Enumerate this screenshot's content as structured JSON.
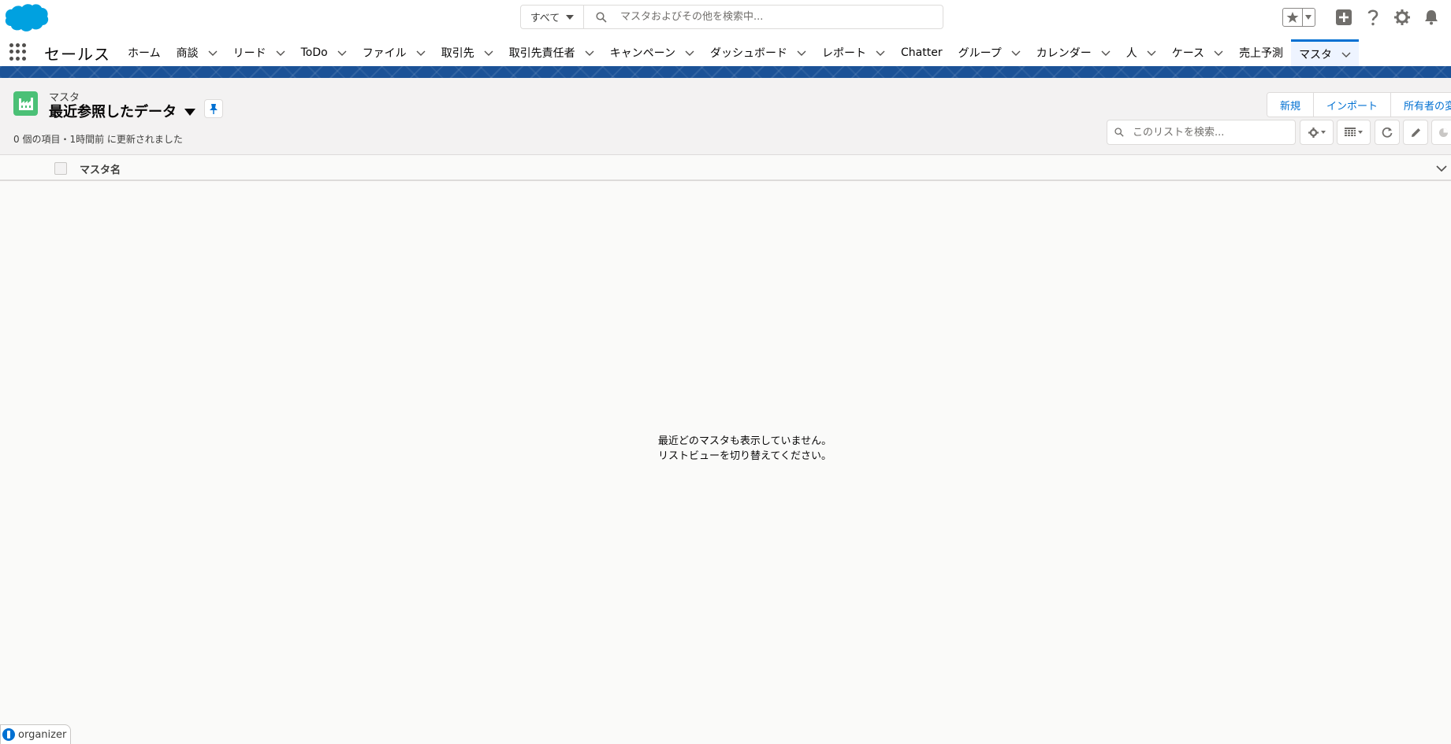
{
  "header": {
    "logo": "salesforce-cloud-logo",
    "search": {
      "scope_label": "すべて",
      "placeholder": "マスタおよびその他を検索中..."
    },
    "icons": [
      "star-icon",
      "chevron-down-icon",
      "plus-icon",
      "help-icon",
      "gear-icon",
      "bell-icon"
    ]
  },
  "nav": {
    "app_name": "セールス",
    "items": [
      {
        "label": "ホーム",
        "dropdown": false
      },
      {
        "label": "商談",
        "dropdown": true
      },
      {
        "label": "リード",
        "dropdown": true
      },
      {
        "label": "ToDo",
        "dropdown": true
      },
      {
        "label": "ファイル",
        "dropdown": true
      },
      {
        "label": "取引先",
        "dropdown": true
      },
      {
        "label": "取引先責任者",
        "dropdown": true
      },
      {
        "label": "キャンペーン",
        "dropdown": true
      },
      {
        "label": "ダッシュボード",
        "dropdown": true
      },
      {
        "label": "レポート",
        "dropdown": true
      },
      {
        "label": "Chatter",
        "dropdown": false
      },
      {
        "label": "グループ",
        "dropdown": true
      },
      {
        "label": "カレンダー",
        "dropdown": true
      },
      {
        "label": "人",
        "dropdown": true
      },
      {
        "label": "ケース",
        "dropdown": true
      },
      {
        "label": "売上予測",
        "dropdown": false
      },
      {
        "label": "マスタ",
        "dropdown": true,
        "active": true
      }
    ]
  },
  "list_view": {
    "object_label": "マスタ",
    "view_name": "最近参照したデータ",
    "meta": "0 個の項目・1時間前 に更新されました",
    "buttons": [
      "新規",
      "インポート",
      "所有者の変"
    ],
    "search_placeholder": "このリストを検索...",
    "columns": [
      "マスタ名"
    ],
    "empty_line1": "最近どのマスタも表示していません。",
    "empty_line2": "リストビューを切り替えてください。"
  },
  "organizer": {
    "label": "organizer"
  },
  "colors": {
    "brand_blue": "#0070d2",
    "band_blue": "#1b5297",
    "object_icon_green": "#4bc076"
  }
}
